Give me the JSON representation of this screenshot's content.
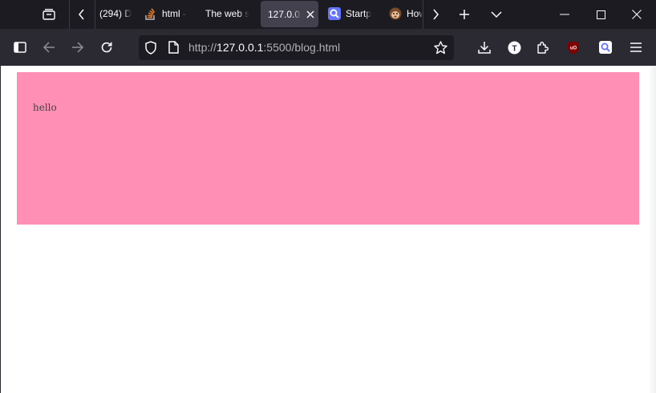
{
  "tabs": [
    {
      "label": "(294) D",
      "icon": "youtube-icon"
    },
    {
      "label": "html -",
      "icon": "stackoverflow-icon"
    },
    {
      "label": "The web s",
      "icon": "none"
    },
    {
      "label": "127.0.0.",
      "icon": "none",
      "active": true
    },
    {
      "label": "Startp",
      "icon": "startpage-icon"
    },
    {
      "label": "How",
      "icon": "monkey-icon"
    }
  ],
  "urlbar": {
    "prefix": "http://",
    "host": "127.0.0.1",
    "rest": ":5500/blog.html"
  },
  "page": {
    "text": "hello",
    "box_color": "#ff8fb4"
  },
  "colors": {
    "titlebar": "#1c1b22",
    "toolbar": "#2b2a33",
    "active_tab": "#42414d",
    "ublock": "#800000"
  }
}
